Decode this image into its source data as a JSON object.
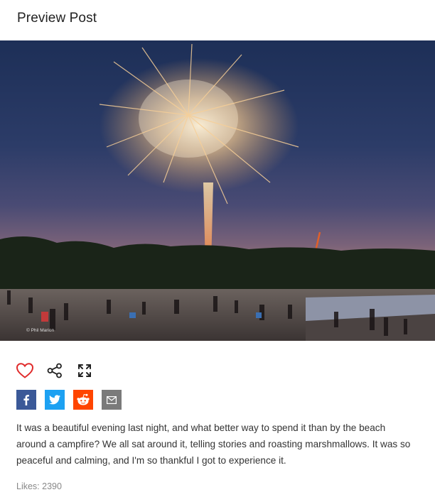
{
  "header": {
    "title": "Preview Post"
  },
  "photo": {
    "credit": "© Phil Marion"
  },
  "actions": [
    {
      "name": "heart-icon",
      "color": "#e02b2b"
    },
    {
      "name": "share-icon",
      "color": "#222222"
    },
    {
      "name": "expand-icon",
      "color": "#222222"
    }
  ],
  "social": [
    {
      "name": "facebook-share-button",
      "color": "#3b5998"
    },
    {
      "name": "twitter-share-button",
      "color": "#1da1f2"
    },
    {
      "name": "reddit-share-button",
      "color": "#ff4500"
    },
    {
      "name": "email-share-button",
      "color": "#7a7a7a"
    }
  ],
  "post": {
    "description": "It was a beautiful evening last night, and what better way to spend it than by the beach around a campfire? We all sat around it, telling stories and roasting marshmallows. It was so peaceful and calming, and I'm so thankful I got to experience it.",
    "likes": "Likes: 2390"
  }
}
